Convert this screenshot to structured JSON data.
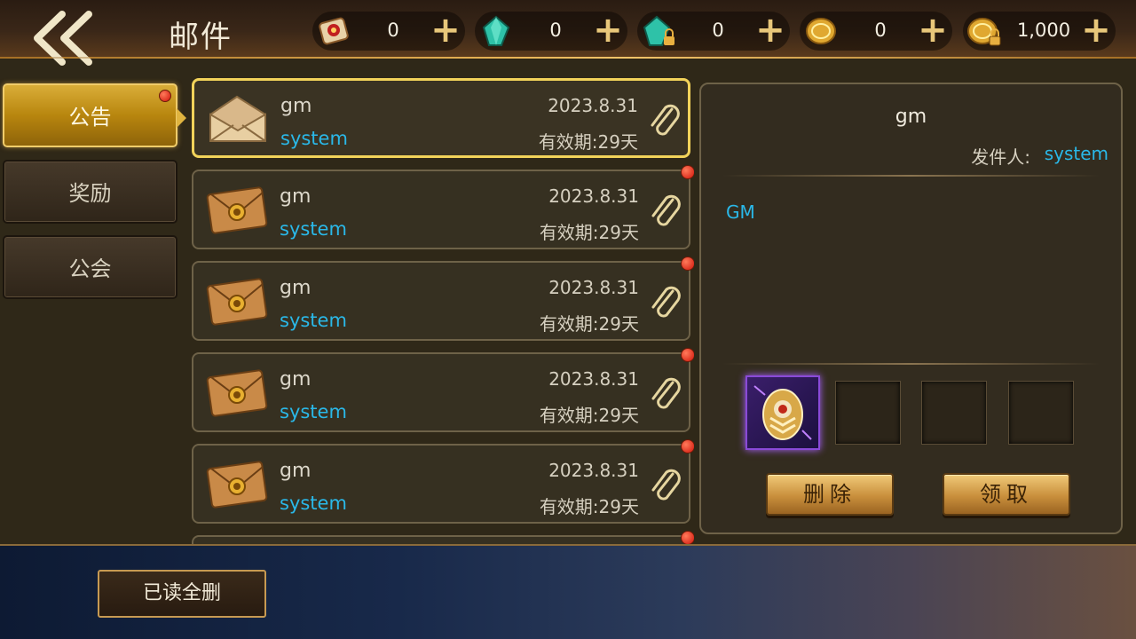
{
  "header": {
    "title": "邮件",
    "back_icon": "double-chevron-left-icon",
    "resources": [
      {
        "icon": "red-scroll-icon",
        "value": "0"
      },
      {
        "icon": "green-crystal-icon",
        "value": "0"
      },
      {
        "icon": "green-crystal-locked-icon",
        "value": "0"
      },
      {
        "icon": "gold-coin-icon",
        "value": "0"
      },
      {
        "icon": "gold-coin-locked-icon",
        "value": "1,000"
      }
    ],
    "plus_glyph": "+"
  },
  "tabs": [
    {
      "label": "公告",
      "active": true,
      "has_notification": true
    },
    {
      "label": "奖励",
      "active": false,
      "has_notification": false
    },
    {
      "label": "公会",
      "active": false,
      "has_notification": false
    }
  ],
  "mails": [
    {
      "title": "gm",
      "sender": "system",
      "date": "2023.8.31",
      "expiry": "有效期:29天",
      "opened": true,
      "unread_dot": false,
      "selected": true
    },
    {
      "title": "gm",
      "sender": "system",
      "date": "2023.8.31",
      "expiry": "有效期:29天",
      "opened": false,
      "unread_dot": true,
      "selected": false
    },
    {
      "title": "gm",
      "sender": "system",
      "date": "2023.8.31",
      "expiry": "有效期:29天",
      "opened": false,
      "unread_dot": true,
      "selected": false
    },
    {
      "title": "gm",
      "sender": "system",
      "date": "2023.8.31",
      "expiry": "有效期:29天",
      "opened": false,
      "unread_dot": true,
      "selected": false
    },
    {
      "title": "gm",
      "sender": "system",
      "date": "2023.8.31",
      "expiry": "有效期:29天",
      "opened": false,
      "unread_dot": true,
      "selected": false
    },
    {
      "title": "",
      "sender": "",
      "date": "",
      "expiry": "",
      "opened": false,
      "unread_dot": true,
      "selected": false
    }
  ],
  "detail": {
    "title": "gm",
    "sender_label": "发件人:",
    "sender": "system",
    "body": "GM",
    "attachments": [
      {
        "icon": "purple-egg-item-icon",
        "filled": true
      },
      {
        "filled": false
      },
      {
        "filled": false
      },
      {
        "filled": false
      }
    ],
    "delete_label": "删除",
    "claim_label": "领取"
  },
  "footer": {
    "read_delete_label": "已读全删"
  },
  "colors": {
    "accent_gold": "#f2d35a",
    "sender_blue": "#2ab8e8",
    "notification_red": "#d0140a"
  }
}
